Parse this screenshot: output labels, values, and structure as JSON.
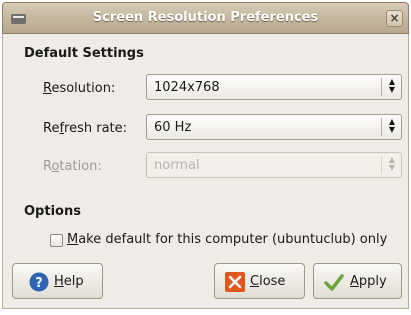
{
  "window": {
    "title": "Screen Resolution Preferences",
    "close_glyph": "×"
  },
  "default_settings": {
    "heading": "Default Settings",
    "resolution": {
      "mnemonic": "R",
      "rest": "esolution:",
      "value": "1024x768",
      "enabled": true
    },
    "refresh_rate": {
      "before": "Re",
      "mnemonic": "f",
      "rest": "resh rate:",
      "value": "60 Hz",
      "enabled": true
    },
    "rotation": {
      "before": "R",
      "mnemonic": "o",
      "rest": "tation:",
      "value": "normal",
      "enabled": false
    }
  },
  "options": {
    "heading": "Options",
    "make_default": {
      "mnemonic": "M",
      "rest": "ake default for this computer (ubuntuclub) only",
      "checked": false
    }
  },
  "buttons": {
    "help": {
      "mnemonic": "H",
      "rest": "elp",
      "icon": "help-icon"
    },
    "close": {
      "mnemonic": "C",
      "rest": "lose",
      "icon": "close-x-icon"
    },
    "apply": {
      "mnemonic": "A",
      "rest": "pply",
      "icon": "checkmark-icon"
    }
  },
  "colors": {
    "titlebar": "#c7b9a1",
    "dialog_bg": "#efebe7",
    "help_icon": "#2f63b5",
    "close_icon": "#e3561b",
    "apply_icon": "#6aa639"
  }
}
